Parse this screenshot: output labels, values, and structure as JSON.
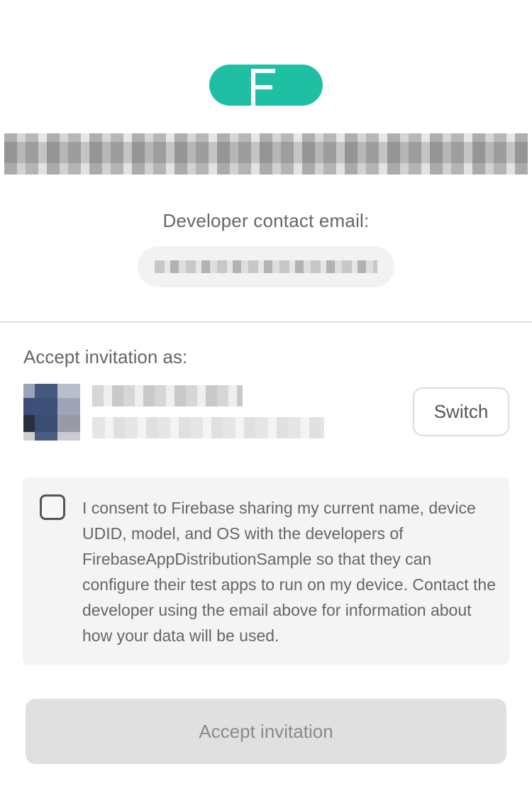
{
  "header": {
    "logo_icon": "firebase-app-distribution-logo",
    "logo_color": "#1fbfa3",
    "app_name_redacted": true
  },
  "developer": {
    "contact_label": "Developer contact email:",
    "email_redacted": true
  },
  "accept_section": {
    "label": "Accept invitation as:",
    "user_redacted": true,
    "switch_label": "Switch"
  },
  "consent": {
    "checked": false,
    "text": "I consent to Firebase sharing my current name, device UDID, model, and OS with the developers of FirebaseAppDistributionSample so that they can configure their test apps to run on my device. Contact the developer using the email above for information about how your data will be used."
  },
  "footer": {
    "accept_label": "Accept invitation",
    "accept_enabled": false
  }
}
